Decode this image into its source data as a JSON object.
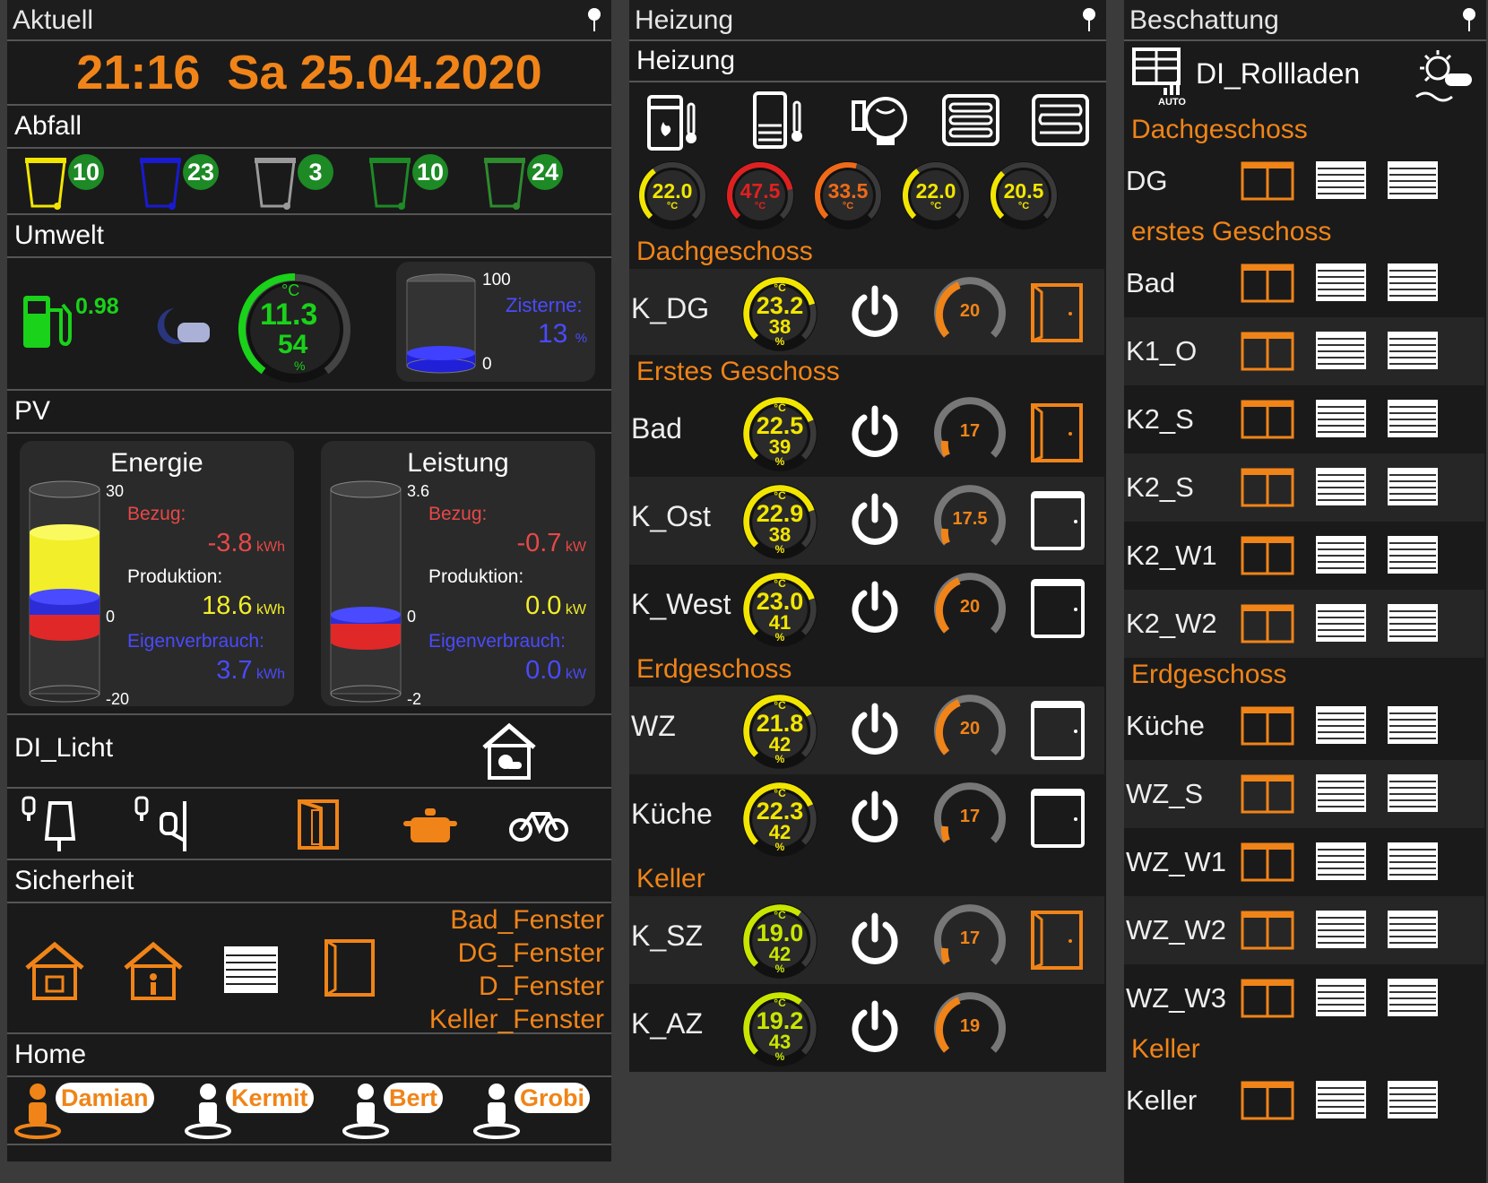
{
  "aktuell": {
    "title": "Aktuell",
    "clock": "21:16  Sa 25.04.2020",
    "abfall": {
      "title": "Abfall",
      "bins": [
        {
          "name": "gelb",
          "color": "#f2e600",
          "count": "10"
        },
        {
          "name": "blau",
          "color": "#1a1ad0",
          "count": "23"
        },
        {
          "name": "grau",
          "color": "#9a9a9a",
          "count": "3"
        },
        {
          "name": "bio",
          "color": "#1d8a25",
          "count": "10"
        },
        {
          "name": "gruen",
          "color": "#2e8b2e",
          "count": "24"
        }
      ]
    },
    "umwelt": {
      "title": "Umwelt",
      "fuel_price": "0.98",
      "temp": "11.3",
      "temp_unit": "°C",
      "humidity": "54",
      "humidity_unit": "%",
      "zisterne": {
        "label": "Zisterne:",
        "value": "13",
        "unit": "%",
        "max": "100",
        "min": "0",
        "fill_percent": 13
      }
    },
    "pv": {
      "title": "PV",
      "energie": {
        "title": "Energie",
        "max": "30",
        "zero": "0",
        "min": "-20",
        "bezug_label": "Bezug:",
        "bezug": "-3.8",
        "bezug_unit": "kWh",
        "produktion_label": "Produktion:",
        "produktion": "18.6",
        "produktion_unit": "kWh",
        "eigen_label": "Eigenverbrauch:",
        "eigen": "3.7",
        "eigen_unit": "kWh"
      },
      "leistung": {
        "title": "Leistung",
        "max": "3.6",
        "zero": "0",
        "min": "-2",
        "bezug_label": "Bezug:",
        "bezug": "-0.7",
        "bezug_unit": "kW",
        "produktion_label": "Produktion:",
        "produktion": "0.0",
        "produktion_unit": "kW",
        "eigen_label": "Eigenverbrauch:",
        "eigen": "0.0",
        "eigen_unit": "kW"
      }
    },
    "licht": {
      "title": "DI_Licht"
    },
    "sicherheit": {
      "title": "Sicherheit",
      "windows": [
        "Bad_Fenster",
        "DG_Fenster",
        "D_Fenster",
        "Keller_Fenster"
      ]
    },
    "home": {
      "title": "Home",
      "persons": [
        {
          "name": "Damian",
          "present": true
        },
        {
          "name": "Kermit",
          "present": false
        },
        {
          "name": "Bert",
          "present": false
        },
        {
          "name": "Grobi",
          "present": false
        }
      ]
    }
  },
  "heizung": {
    "title": "Heizung",
    "subtitle": "Heizung",
    "top_gauges": [
      {
        "value": "22.0",
        "unit": "°C",
        "color": "#f2e600"
      },
      {
        "value": "47.5",
        "unit": "°C",
        "color": "#e02020"
      },
      {
        "value": "33.5",
        "unit": "°C",
        "color": "#f06a18"
      },
      {
        "value": "22.0",
        "unit": "°C",
        "color": "#f2e600"
      },
      {
        "value": "20.5",
        "unit": "°C",
        "color": "#f2e600"
      }
    ],
    "floors": [
      {
        "name": "Dachgeschoss",
        "rooms": [
          {
            "name": "K_DG",
            "temp": "23.2",
            "hum": "38",
            "set": "20",
            "window": "open"
          }
        ]
      },
      {
        "name": "Erstes Geschoss",
        "rooms": [
          {
            "name": "Bad",
            "temp": "22.5",
            "hum": "39",
            "set": "17",
            "window": "open"
          },
          {
            "name": "K_Ost",
            "temp": "22.9",
            "hum": "38",
            "set": "17.5",
            "window": "closed"
          },
          {
            "name": "K_West",
            "temp": "23.0",
            "hum": "41",
            "set": "20",
            "window": "closed"
          }
        ]
      },
      {
        "name": "Erdgeschoss",
        "rooms": [
          {
            "name": "WZ",
            "temp": "21.8",
            "hum": "42",
            "set": "20",
            "window": "closed"
          },
          {
            "name": "Küche",
            "temp": "22.3",
            "hum": "42",
            "set": "17",
            "window": "closed"
          }
        ]
      },
      {
        "name": "Keller",
        "rooms": [
          {
            "name": "K_SZ",
            "temp": "19.0",
            "hum": "42",
            "set": "17",
            "window": "open"
          },
          {
            "name": "K_AZ",
            "temp": "19.2",
            "hum": "43",
            "set": "19",
            "window": "none"
          }
        ]
      }
    ],
    "temp_unit": "°C",
    "hum_unit": "%"
  },
  "beschattung": {
    "title": "Beschattung",
    "master": "DI_Rollladen",
    "auto_label": "AUTO",
    "floors": [
      {
        "name": "Dachgeschoss",
        "rooms": [
          "DG"
        ]
      },
      {
        "name": "erstes Geschoss",
        "rooms": [
          "Bad",
          "K1_O",
          "K2_S",
          "K2_S",
          "K2_W1",
          "K2_W2"
        ]
      },
      {
        "name": "Erdgeschoss",
        "rooms": [
          "Küche",
          "WZ_S",
          "WZ_W1",
          "WZ_W2",
          "WZ_W3"
        ]
      },
      {
        "name": "Keller",
        "rooms": [
          "Keller"
        ]
      }
    ]
  }
}
